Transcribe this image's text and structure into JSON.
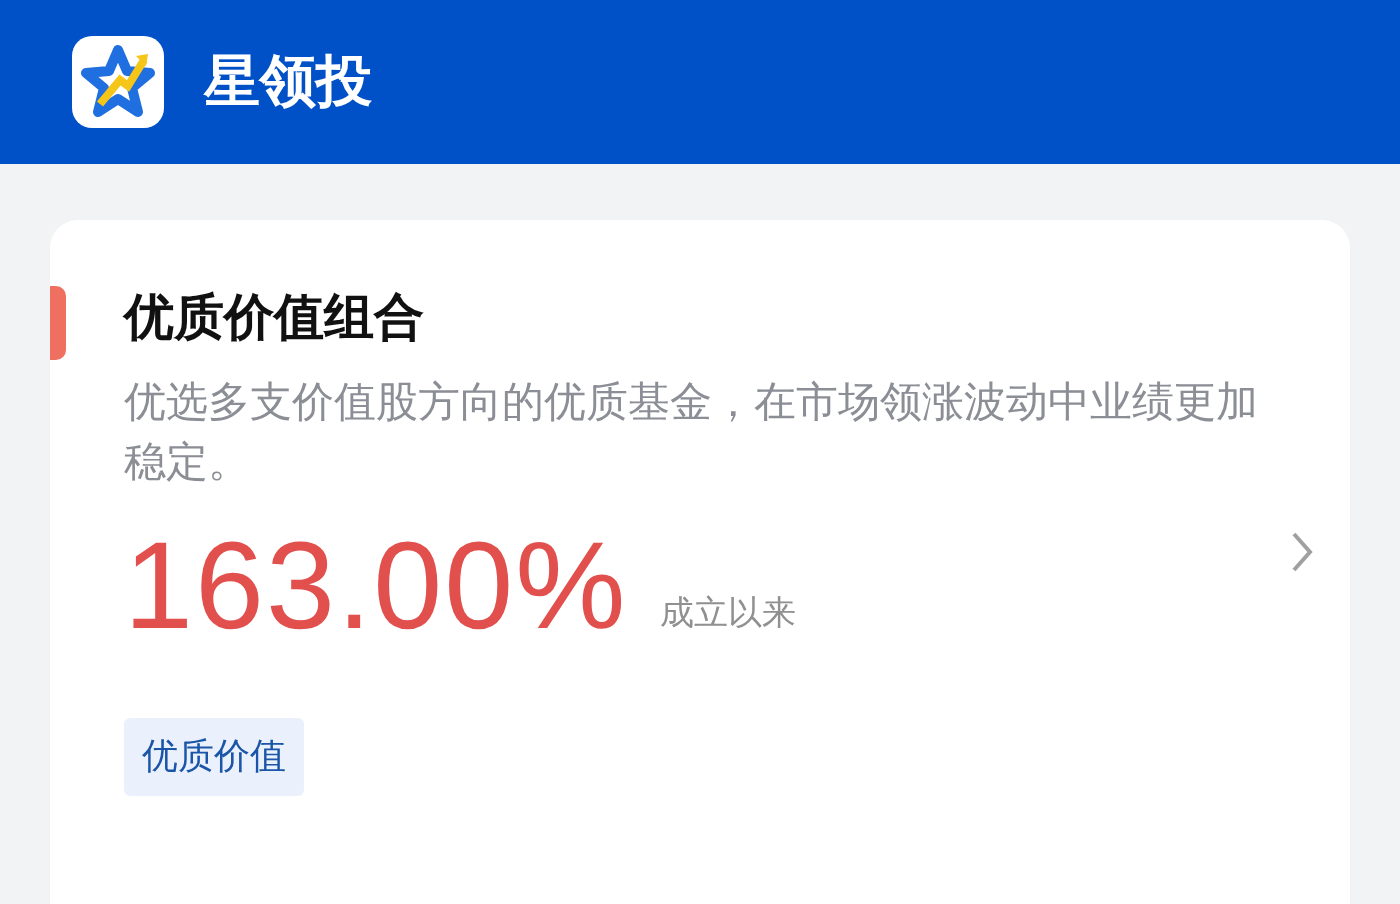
{
  "app_bar": {
    "title": "星领投"
  },
  "card": {
    "title": "优质价值组合",
    "description": "优选多支价值股方向的优质基金，在市场领涨波动中业绩更加稳定。",
    "return_value": "163.00%",
    "return_label": "成立以来",
    "tags": [
      "优质价值"
    ]
  }
}
